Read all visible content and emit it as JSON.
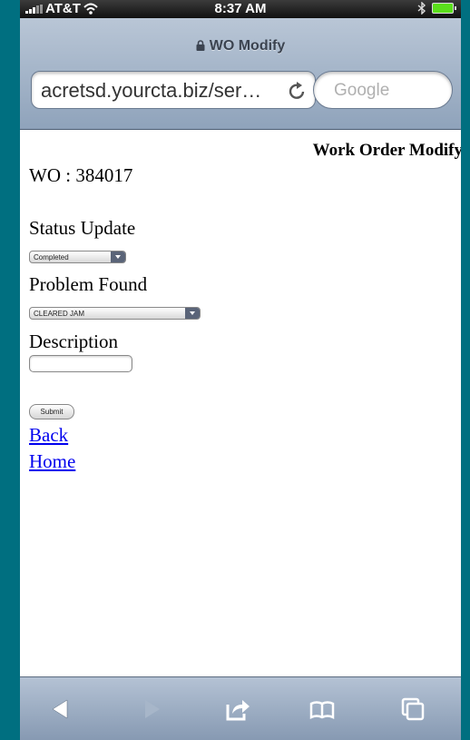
{
  "status_bar": {
    "carrier": "AT&T",
    "time": "8:37 AM"
  },
  "browser": {
    "page_title": "WO Modify",
    "url": "acretsd.yourcta.biz/ser…",
    "search_placeholder": "Google"
  },
  "page": {
    "heading": "Work Order Modify",
    "wo_label": "WO : 384017",
    "status_label": "Status Update",
    "status_value": "Completed",
    "problem_label": "Problem Found",
    "problem_value": "CLEARED JAM",
    "description_label": "Description",
    "description_value": "",
    "submit_label": "Submit",
    "back_link": "Back",
    "home_link": "Home"
  },
  "toolbar": {
    "icons": [
      "back-arrow-icon",
      "forward-arrow-icon",
      "share-icon",
      "bookmarks-icon",
      "pages-icon"
    ]
  }
}
